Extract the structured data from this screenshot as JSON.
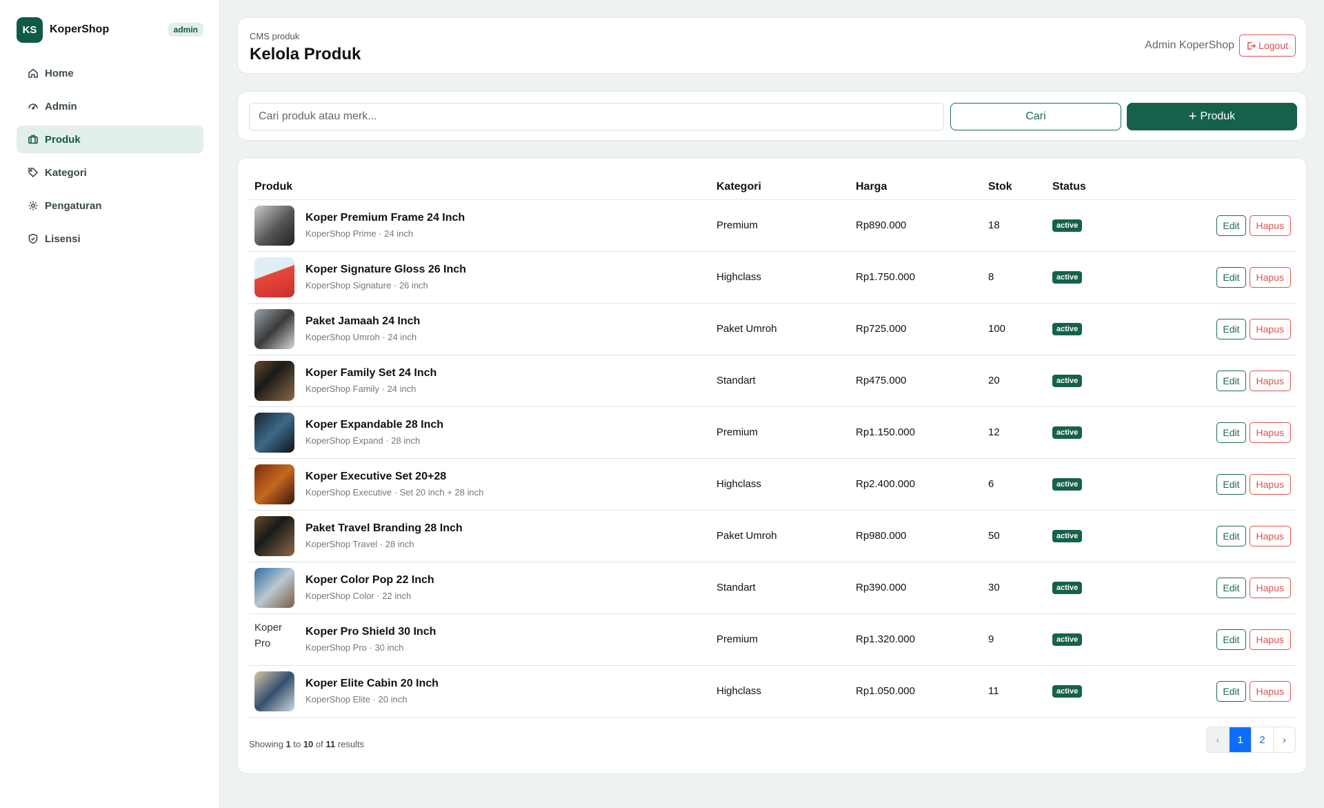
{
  "brand": {
    "logo": "KS",
    "name": "KoperShop",
    "badge": "admin"
  },
  "nav": [
    {
      "label": "Home",
      "icon": "home-icon"
    },
    {
      "label": "Admin",
      "icon": "dashboard-icon"
    },
    {
      "label": "Produk",
      "icon": "suitcase-icon",
      "active": true
    },
    {
      "label": "Kategori",
      "icon": "tag-icon"
    },
    {
      "label": "Pengaturan",
      "icon": "gear-icon"
    },
    {
      "label": "Lisensi",
      "icon": "shield-icon"
    }
  ],
  "header": {
    "crumb": "CMS produk",
    "title": "Kelola Produk",
    "user": "Admin KoperShop",
    "logout": "Logout"
  },
  "search": {
    "placeholder": "Cari produk atau merk...",
    "button": "Cari",
    "add_button": "Produk"
  },
  "table": {
    "headers": [
      "Produk",
      "Kategori",
      "Harga",
      "Stok",
      "Status"
    ],
    "rows": [
      {
        "name": "Koper Premium Frame 24 Inch",
        "sub": "KoperShop Prime · 24 inch",
        "kategori": "Premium",
        "harga": "Rp890.000",
        "stok": "18",
        "status": "active"
      },
      {
        "name": "Koper Signature Gloss 26 Inch",
        "sub": "KoperShop Signature · 26 inch",
        "kategori": "Highclass",
        "harga": "Rp1.750.000",
        "stok": "8",
        "status": "active"
      },
      {
        "name": "Paket Jamaah 24 Inch",
        "sub": "KoperShop Umroh · 24 inch",
        "kategori": "Paket Umroh",
        "harga": "Rp725.000",
        "stok": "100",
        "status": "active"
      },
      {
        "name": "Koper Family Set 24 Inch",
        "sub": "KoperShop Family · 24 inch",
        "kategori": "Standart",
        "harga": "Rp475.000",
        "stok": "20",
        "status": "active"
      },
      {
        "name": "Koper Expandable 28 Inch",
        "sub": "KoperShop Expand · 28 inch",
        "kategori": "Premium",
        "harga": "Rp1.150.000",
        "stok": "12",
        "status": "active"
      },
      {
        "name": "Koper Executive Set 20+28",
        "sub": "KoperShop Executive · Set 20 inch + 28 inch",
        "kategori": "Highclass",
        "harga": "Rp2.400.000",
        "stok": "6",
        "status": "active"
      },
      {
        "name": "Paket Travel Branding 28 Inch",
        "sub": "KoperShop Travel · 28 inch",
        "kategori": "Paket Umroh",
        "harga": "Rp980.000",
        "stok": "50",
        "status": "active"
      },
      {
        "name": "Koper Color Pop 22 Inch",
        "sub": "KoperShop Color · 22 inch",
        "kategori": "Standart",
        "harga": "Rp390.000",
        "stok": "30",
        "status": "active"
      },
      {
        "name": "Koper Pro Shield 30 Inch",
        "sub": "KoperShop Pro · 30 inch",
        "kategori": "Premium",
        "harga": "Rp1.320.000",
        "stok": "9",
        "status": "active",
        "broken_image_alt": "Koper Pro"
      },
      {
        "name": "Koper Elite Cabin 20 Inch",
        "sub": "KoperShop Elite · 20 inch",
        "kategori": "Highclass",
        "harga": "Rp1.050.000",
        "stok": "11",
        "status": "active"
      }
    ],
    "edit_label": "Edit",
    "delete_label": "Hapus"
  },
  "footer": {
    "showing_prefix": "Showing",
    "from": "1",
    "to_word": "to",
    "to": "10",
    "of_word": "of",
    "total": "11",
    "suffix": "results"
  },
  "pagination": {
    "prev": "‹",
    "pages": [
      "1",
      "2"
    ],
    "current": "1",
    "next": "›"
  },
  "colors": {
    "brand": "#0f5a46",
    "danger": "#d9534f",
    "page_active": "#0d6efd"
  }
}
